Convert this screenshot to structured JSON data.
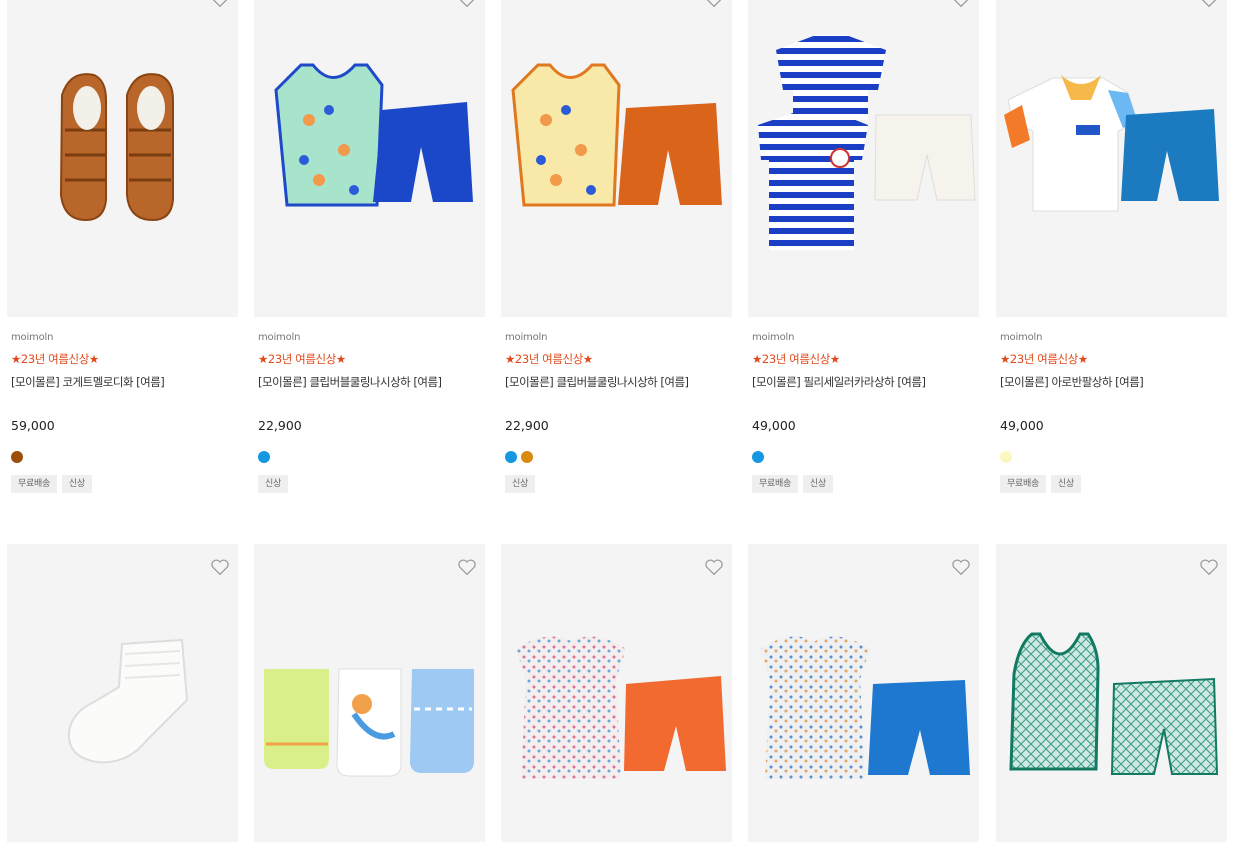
{
  "row1": [
    {
      "brand": "moimoln",
      "promo": "★23년 여름신상★",
      "name": "[모이몰른] 코게트멜로디화 [여름]",
      "price": "59,000",
      "colors": [
        "#9c4f08"
      ],
      "tags": [
        "무료배송",
        "신상"
      ],
      "image": "sandals"
    },
    {
      "brand": "moimoln",
      "promo": "★23년 여름신상★",
      "name": "[모이몰른] 클립버블쿨링나시상하 [여름]",
      "price": "22,900",
      "colors": [
        "#1698e0"
      ],
      "tags": [
        "신상"
      ],
      "image": "mint-tank-blue-shorts"
    },
    {
      "brand": "moimoln",
      "promo": "★23년 여름신상★",
      "name": "[모이몰른] 클립버블쿨링나시상하 [여름]",
      "price": "22,900",
      "colors": [
        "#1698e0",
        "#d98a10"
      ],
      "tags": [
        "신상"
      ],
      "image": "yellow-tank-orange-shorts"
    },
    {
      "brand": "moimoln",
      "promo": "★23년 여름신상★",
      "name": "[모이몰른] 필리세일러카라상하 [여름]",
      "price": "49,000",
      "colors": [
        "#1698e0"
      ],
      "tags": [
        "무료배송",
        "신상"
      ],
      "image": "striped-sailor-set"
    },
    {
      "brand": "moimoln",
      "promo": "★23년 여름신상★",
      "name": "[모이몰른] 아로반팔상하 [여름]",
      "price": "49,000",
      "colors": [
        "#fbf7c0"
      ],
      "tags": [
        "무료배송",
        "신상"
      ],
      "image": "polo-blue-shorts"
    }
  ],
  "row2": [
    {
      "image": "white-socks"
    },
    {
      "image": "socks-set"
    },
    {
      "image": "floral-top-orange-shorts"
    },
    {
      "image": "floral-top-blue-shorts"
    },
    {
      "image": "green-tank-set"
    }
  ]
}
